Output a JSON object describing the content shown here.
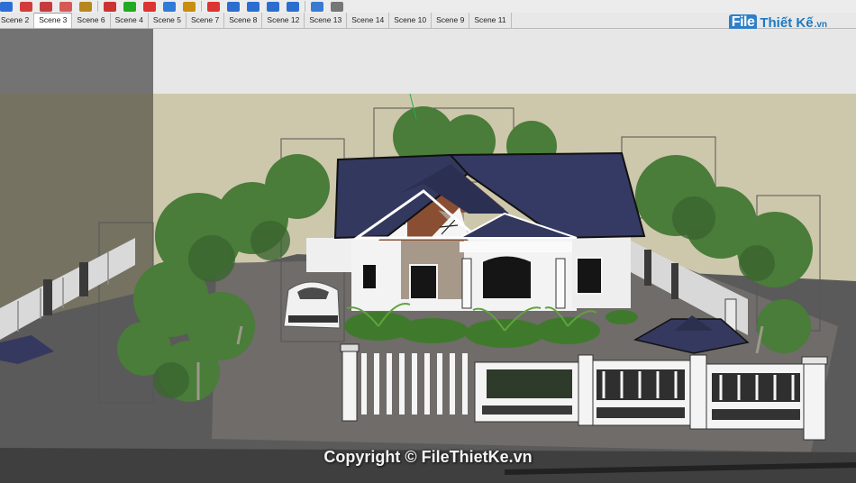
{
  "toolbar": {
    "icons": [
      "select-arrow-icon",
      "eraser-icon",
      "pencil-icon",
      "arc-icon",
      "paint-bucket-icon",
      "push-pull-icon",
      "move-icon",
      "rotate-icon",
      "offset-icon",
      "tape-measure-icon",
      "paint-icon",
      "orbit-icon",
      "zoom-icon",
      "zoom-extents-icon",
      "walk-icon",
      "look-around-icon",
      "section-icon"
    ]
  },
  "scenes": {
    "tabs": [
      "Scene 2",
      "Scene 3",
      "Scene 6",
      "Scene 4",
      "Scene 5",
      "Scene 7",
      "Scene 8",
      "Scene 12",
      "Scene 13",
      "Scene 14",
      "Scene 10",
      "Scene 9",
      "Scene 11"
    ],
    "active": "Scene 3"
  },
  "logo": {
    "file": "File",
    "name": "Thiết Kế",
    "tld": ".vn"
  },
  "watermark": "Copyright © FileThietKe.vn",
  "colors": {
    "roof": "#353a63",
    "sky": "#cdc8ab",
    "ground": "#5c5c5c",
    "tree": "#4c7d3b",
    "brick": "#8a4f33"
  }
}
